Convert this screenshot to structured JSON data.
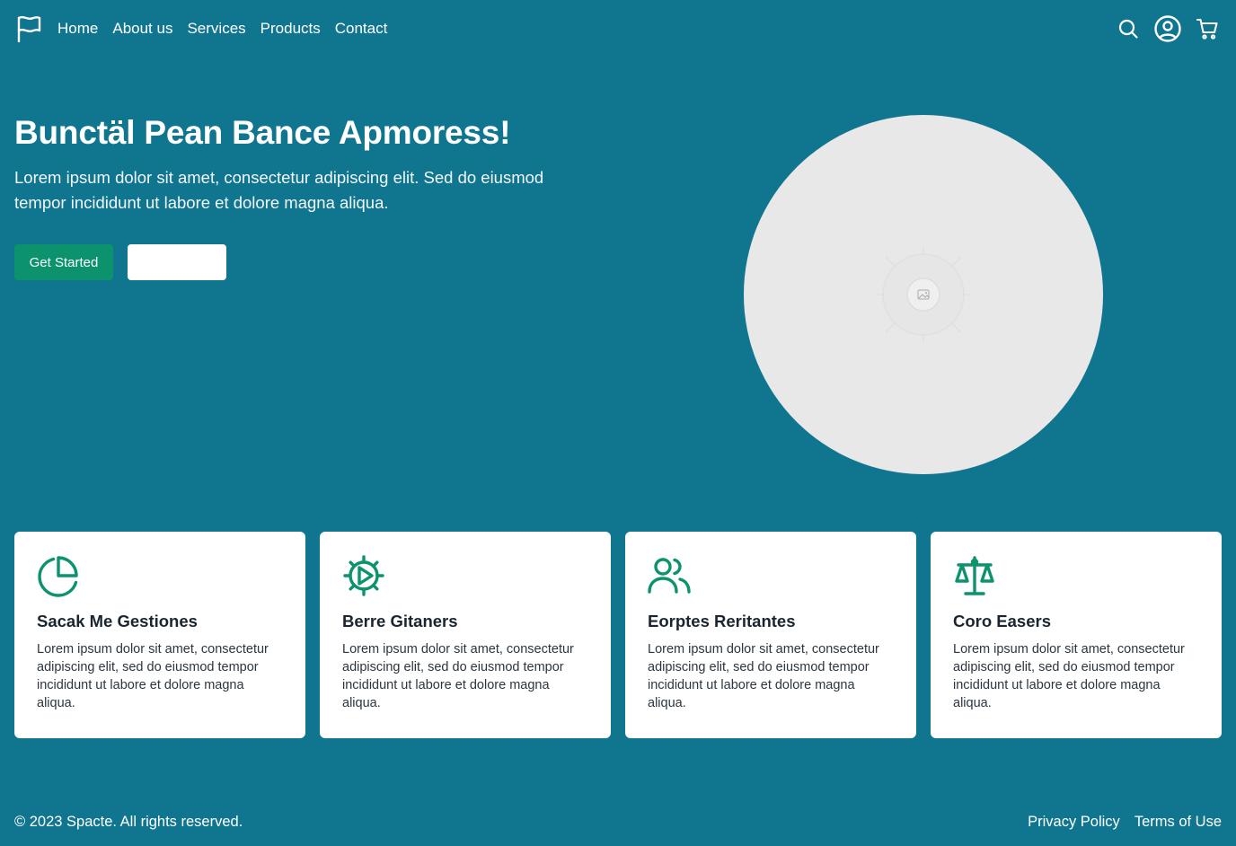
{
  "colors": {
    "background": "#10758f",
    "accent_green": "#0c936e",
    "card_background": "#ffffff",
    "image_placeholder": "#e8e8e8"
  },
  "header": {
    "logo_icon": "flag-icon",
    "nav": [
      {
        "label": "Home"
      },
      {
        "label": "About us"
      },
      {
        "label": "Services"
      },
      {
        "label": "Products"
      },
      {
        "label": "Contact"
      }
    ],
    "icons": [
      "search-icon",
      "account-icon",
      "cart-icon"
    ]
  },
  "hero": {
    "title": "Bunctäl Pean Bance Apmoress!",
    "text": "Lorem ipsum dolor sit amet, consectetur adipiscing elit. Sed do eiusmod tempor incididunt ut labore et dolore magna aliqua.",
    "primary_button": "Get Started",
    "secondary_button": "",
    "image_icon": "image-placeholder-icon"
  },
  "features": [
    {
      "icon": "pie-chart-icon",
      "title": "Sacak Me Gestiones",
      "text": "Lorem ipsum dolor sit amet, consectetur adipiscing elit, sed do eiusmod tempor incididunt ut labore et dolore magna aliqua."
    },
    {
      "icon": "gear-icon",
      "title": "Berre Gitaners",
      "text": "Lorem ipsum dolor sit amet, consectetur adipiscing elit, sed do eiusmod tempor incididunt ut labore et dolore magna aliqua."
    },
    {
      "icon": "users-icon",
      "title": "Eorptes Reritantes",
      "text": "Lorem ipsum dolor sit amet, consectetur adipiscing elit, sed do eiusmod tempor incididunt ut labore et dolore magna aliqua."
    },
    {
      "icon": "scale-icon",
      "title": "Coro Easers",
      "text": "Lorem ipsum dolor sit amet, consectetur adipiscing elit, sed do eiusmod tempor incididunt ut labore et dolore magna aliqua."
    }
  ],
  "footer": {
    "copyright": "© 2023 Spacte. All rights reserved.",
    "links": [
      {
        "label": "Privacy Policy"
      },
      {
        "label": "Terms of Use"
      }
    ]
  }
}
